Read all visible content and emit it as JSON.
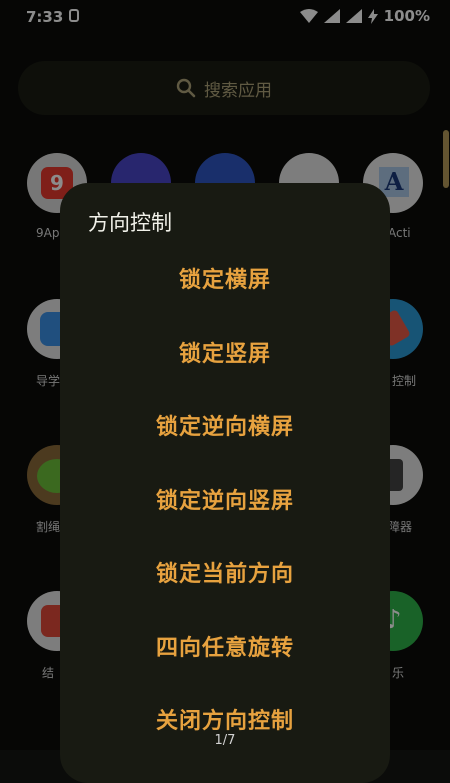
{
  "status_bar": {
    "time": "7:33",
    "battery": "100%"
  },
  "search": {
    "placeholder": "搜索应用"
  },
  "apps": {
    "row1": [
      "9Ap",
      "Acti"
    ],
    "row2": [
      "导学",
      "控制"
    ],
    "row3": [
      "割绳",
      "障器"
    ],
    "row4": [
      "结",
      "乐"
    ]
  },
  "dialog": {
    "title": "方向控制",
    "options": [
      "锁定横屏",
      "锁定竖屏",
      "锁定逆向横屏",
      "锁定逆向竖屏",
      "锁定当前方向",
      "四向任意旋转",
      "关闭方向控制"
    ]
  },
  "pager": "1/7",
  "colors": {
    "accent": "#e7a23f",
    "dialog_bg": "#181a12",
    "page_bg": "#0b0c0a"
  }
}
